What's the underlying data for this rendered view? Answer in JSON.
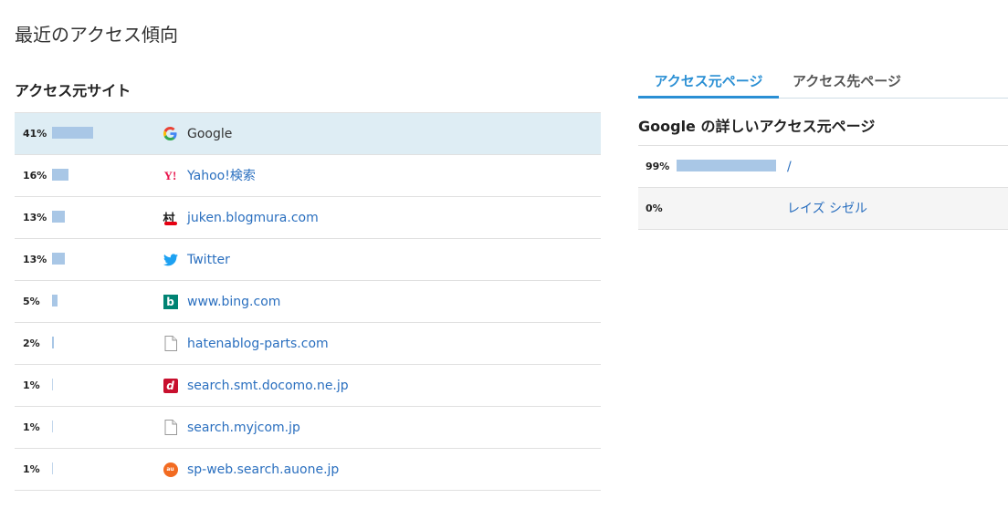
{
  "page_title": "最近のアクセス傾向",
  "sources_section": {
    "title": "アクセス元サイト",
    "rows": [
      {
        "percent_label": "41%",
        "share": 0.41,
        "name": "Google",
        "icon": "google-icon",
        "selected": true
      },
      {
        "percent_label": "16%",
        "share": 0.16,
        "name": "Yahoo!検索",
        "icon": "yahoo-icon",
        "selected": false
      },
      {
        "percent_label": "13%",
        "share": 0.13,
        "name": "juken.blogmura.com",
        "icon": "blogmura-icon",
        "selected": false
      },
      {
        "percent_label": "13%",
        "share": 0.13,
        "name": "Twitter",
        "icon": "twitter-icon",
        "selected": false
      },
      {
        "percent_label": "5%",
        "share": 0.05,
        "name": "www.bing.com",
        "icon": "bing-icon",
        "selected": false
      },
      {
        "percent_label": "2%",
        "share": 0.02,
        "name": "hatenablog-parts.com",
        "icon": "document-icon",
        "selected": false
      },
      {
        "percent_label": "1%",
        "share": 0.01,
        "name": "search.smt.docomo.ne.jp",
        "icon": "docomo-icon",
        "selected": false
      },
      {
        "percent_label": "1%",
        "share": 0.01,
        "name": "search.myjcom.jp",
        "icon": "document-icon",
        "selected": false
      },
      {
        "percent_label": "1%",
        "share": 0.01,
        "name": "sp-web.search.auone.jp",
        "icon": "auone-icon",
        "selected": false
      }
    ]
  },
  "tabs": [
    {
      "label": "アクセス元ページ",
      "active": true
    },
    {
      "label": "アクセス先ページ",
      "active": false
    }
  ],
  "detail": {
    "title": "Google の詳しいアクセス元ページ",
    "rows": [
      {
        "percent_label": "99%",
        "share": 0.99,
        "name": "/"
      },
      {
        "percent_label": "0%",
        "share": 0.0,
        "name": "レイズ シゼル"
      }
    ]
  },
  "colors": {
    "bar": "#a9c7e6",
    "link": "#2a6fbf",
    "tab_active": "#2a8fd4",
    "selected_row": "#deedf4"
  }
}
